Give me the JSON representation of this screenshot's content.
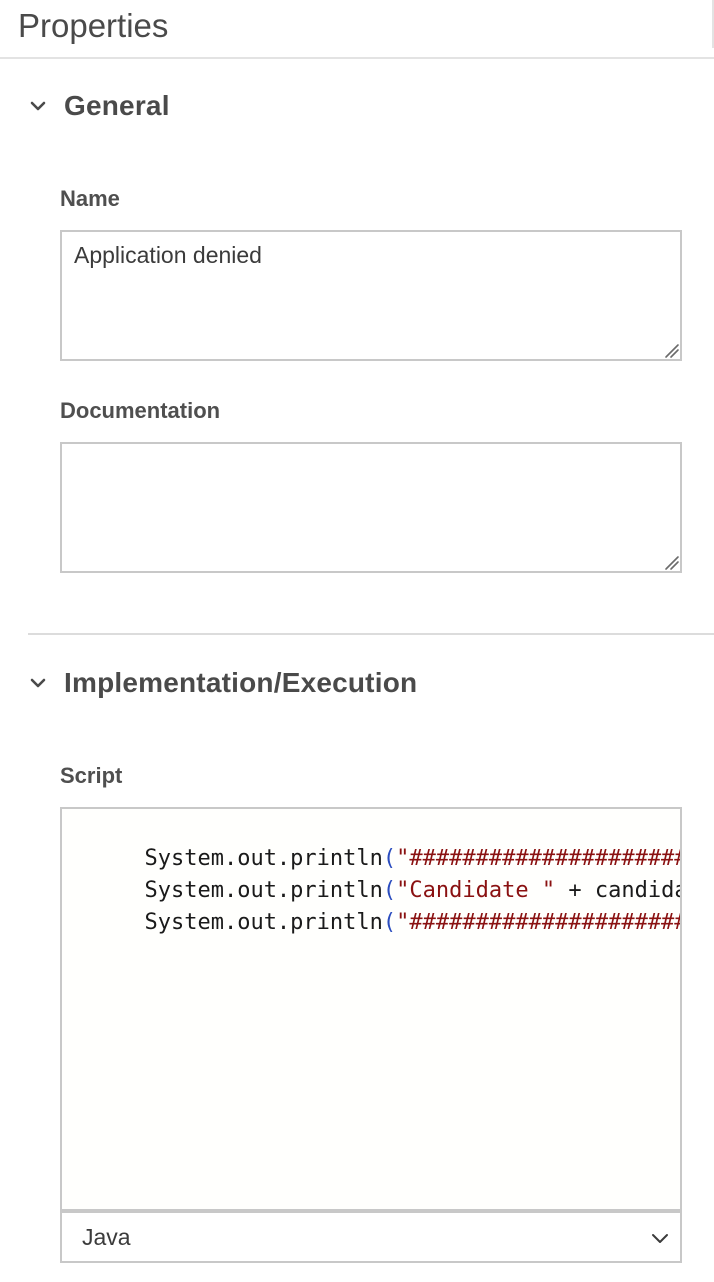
{
  "panel": {
    "title": "Properties"
  },
  "general": {
    "title": "General",
    "name_label": "Name",
    "name_value": "Application denied",
    "documentation_label": "Documentation",
    "documentation_value": ""
  },
  "implementation": {
    "title": "Implementation/Execution",
    "script_label": "Script",
    "script_lines": [
      {
        "prefix": "System.out.println",
        "open": "(",
        "string": "\"############################",
        "rest": ""
      },
      {
        "prefix": "System.out.println",
        "open": "(",
        "string": "\"Candidate \"",
        "rest": " + candidate.get"
      },
      {
        "prefix": "System.out.println",
        "open": "(",
        "string": "\"############################",
        "rest": ""
      }
    ],
    "script_language": "Java"
  },
  "icons": {
    "section_toggle": "chevron-down-icon",
    "select_arrow": "chevron-down-icon",
    "resize": "resize-grip-icon"
  },
  "colors": {
    "string_token": "#8a1111",
    "punct_token": "#2b4dbf",
    "border": "#c8c8c8"
  }
}
